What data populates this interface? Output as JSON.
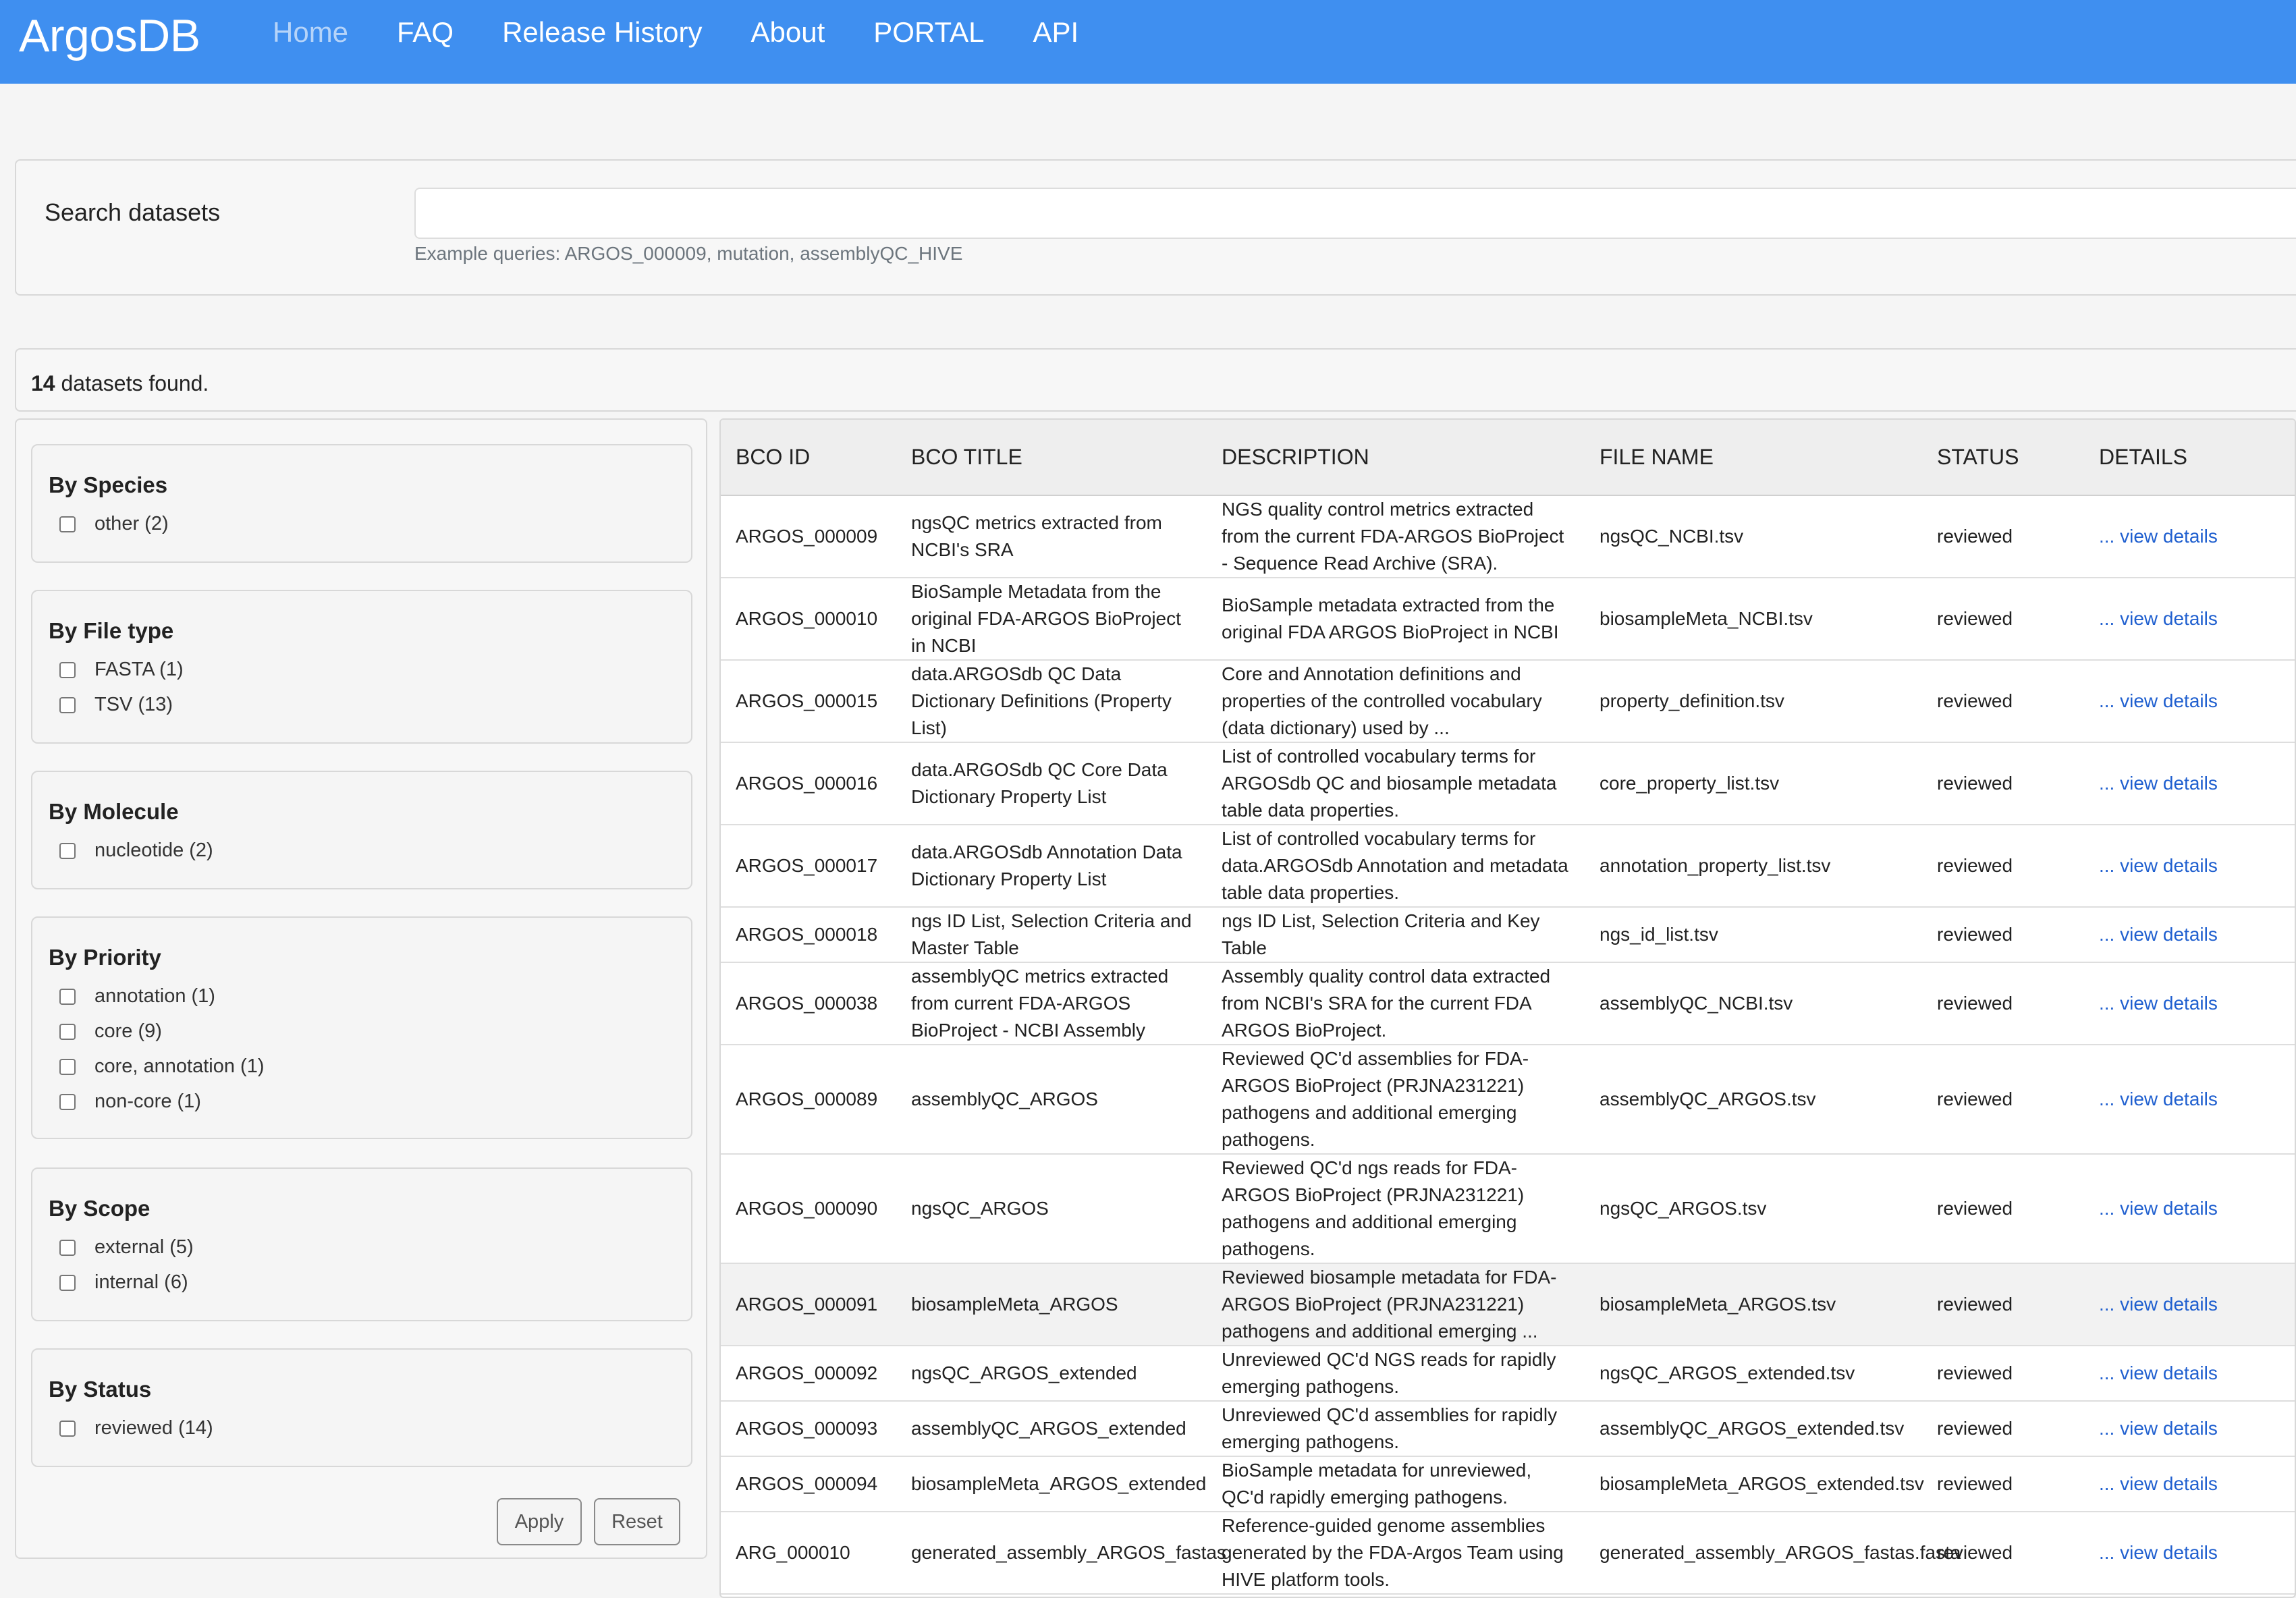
{
  "nav": {
    "brand": "ArgosDB",
    "links": [
      "Home",
      "FAQ",
      "Release History",
      "About",
      "PORTAL",
      "API"
    ]
  },
  "search": {
    "label": "Search datasets",
    "value": "",
    "placeholder": "",
    "hint": "Example queries: ARGOS_000009, mutation, assemblyQC_HIVE"
  },
  "results": {
    "count": "14",
    "suffix": " datasets found."
  },
  "filters": [
    {
      "title": "By Species",
      "options": [
        "other (2)"
      ]
    },
    {
      "title": "By File type",
      "options": [
        "FASTA (1)",
        "TSV (13)"
      ]
    },
    {
      "title": "By Molecule",
      "options": [
        "nucleotide (2)"
      ]
    },
    {
      "title": "By Priority",
      "options": [
        "annotation (1)",
        "core (9)",
        "core, annotation (1)",
        "non-core (1)"
      ]
    },
    {
      "title": "By Scope",
      "options": [
        "external (5)",
        "internal (6)"
      ]
    },
    {
      "title": "By Status",
      "options": [
        "reviewed (14)"
      ]
    }
  ],
  "buttons": {
    "apply": "Apply",
    "reset": "Reset"
  },
  "table": {
    "headers": [
      "BCO ID",
      "BCO TITLE",
      "DESCRIPTION",
      "FILE NAME",
      "STATUS",
      "DETAILS"
    ],
    "rows": [
      {
        "id": "ARGOS_000009",
        "title": "ngsQC metrics extracted from NCBI's SRA",
        "description": "NGS quality control metrics extracted from the current FDA-ARGOS BioProject - Sequence Read Archive (SRA).",
        "file": "ngsQC_NCBI.tsv",
        "status": "reviewed",
        "details": "... view details"
      },
      {
        "id": "ARGOS_000010",
        "title": "BioSample Metadata from the original FDA-ARGOS BioProject in NCBI",
        "description": "BioSample metadata extracted from the original FDA ARGOS BioProject in NCBI",
        "file": "biosampleMeta_NCBI.tsv",
        "status": "reviewed",
        "details": "... view details"
      },
      {
        "id": "ARGOS_000015",
        "title": "data.ARGOSdb QC Data Dictionary Definitions (Property List)",
        "description": "Core and Annotation definitions and properties of the controlled vocabulary (data dictionary) used by ...",
        "file": "property_definition.tsv",
        "status": "reviewed",
        "details": "... view details"
      },
      {
        "id": "ARGOS_000016",
        "title": "data.ARGOSdb QC Core Data Dictionary Property List",
        "description": "List of controlled vocabulary terms for ARGOSdb QC and biosample metadata table data properties.",
        "file": "core_property_list.tsv",
        "status": "reviewed",
        "details": "... view details"
      },
      {
        "id": "ARGOS_000017",
        "title": "data.ARGOSdb Annotation Data Dictionary Property List",
        "description": "List of controlled vocabulary terms for data.ARGOSdb Annotation and metadata table data properties.",
        "file": "annotation_property_list.tsv",
        "status": "reviewed",
        "details": "... view details"
      },
      {
        "id": "ARGOS_000018",
        "title": "ngs ID List, Selection Criteria and Master Table",
        "description": "ngs ID List, Selection Criteria and Key Table",
        "file": "ngs_id_list.tsv",
        "status": "reviewed",
        "details": "... view details"
      },
      {
        "id": "ARGOS_000038",
        "title": "assemblyQC metrics extracted from current FDA-ARGOS BioProject - NCBI Assembly",
        "description": "Assembly quality control data extracted from NCBI's SRA for the current FDA ARGOS BioProject.",
        "file": "assemblyQC_NCBI.tsv",
        "status": "reviewed",
        "details": "... view details"
      },
      {
        "id": "ARGOS_000089",
        "title": "assemblyQC_ARGOS",
        "description": "Reviewed QC'd assemblies for FDA-ARGOS BioProject (PRJNA231221) pathogens and additional emerging pathogens.",
        "file": "assemblyQC_ARGOS.tsv",
        "status": "reviewed",
        "details": "... view details"
      },
      {
        "id": "ARGOS_000090",
        "title": "ngsQC_ARGOS",
        "description": "Reviewed QC'd ngs reads for FDA-ARGOS BioProject (PRJNA231221) pathogens and additional emerging pathogens.",
        "file": "ngsQC_ARGOS.tsv",
        "status": "reviewed",
        "details": "... view details"
      },
      {
        "id": "ARGOS_000091",
        "title": "biosampleMeta_ARGOS",
        "description": "Reviewed biosample metadata for FDA-ARGOS BioProject (PRJNA231221) pathogens and additional emerging ...",
        "file": "biosampleMeta_ARGOS.tsv",
        "status": "reviewed",
        "details": "... view details"
      },
      {
        "id": "ARGOS_000092",
        "title": "ngsQC_ARGOS_extended",
        "description": "Unreviewed QC'd NGS reads for rapidly emerging pathogens.",
        "file": "ngsQC_ARGOS_extended.tsv",
        "status": "reviewed",
        "details": "... view details"
      },
      {
        "id": "ARGOS_000093",
        "title": "assemblyQC_ARGOS_extended",
        "description": "Unreviewed QC'd assemblies for rapidly emerging pathogens.",
        "file": "assemblyQC_ARGOS_extended.tsv",
        "status": "reviewed",
        "details": "... view details"
      },
      {
        "id": "ARGOS_000094",
        "title": "biosampleMeta_ARGOS_extended",
        "description": "BioSample metadata for unreviewed, QC'd rapidly emerging pathogens.",
        "file": "biosampleMeta_ARGOS_extended.tsv",
        "status": "reviewed",
        "details": "... view details"
      },
      {
        "id": "ARG_000010",
        "title": "generated_assembly_ARGOS_fastas",
        "description": "Reference-guided genome assemblies generated by the FDA-Argos Team using HIVE platform tools.",
        "file": "generated_assembly_ARGOS_fastas.fasta",
        "status": "reviewed",
        "details": "... view details"
      }
    ]
  }
}
